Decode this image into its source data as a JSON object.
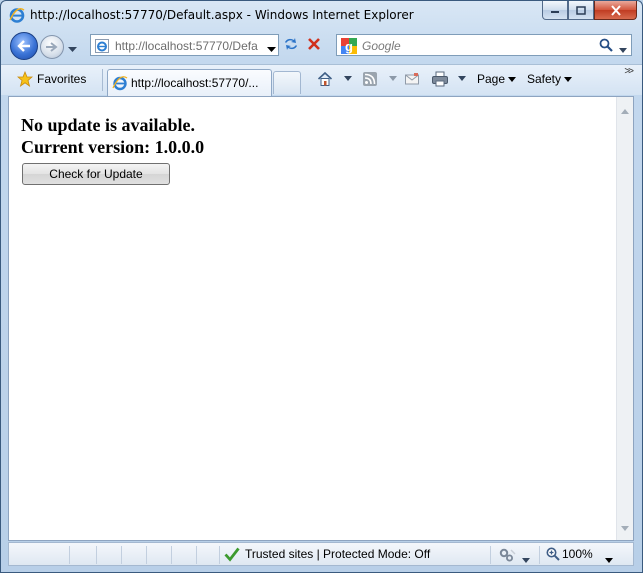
{
  "window": {
    "title": "http://localhost:57770/Default.aspx - Windows Internet Explorer"
  },
  "nav": {
    "address": "http://localhost:57770/Defa",
    "search_placeholder": "Google"
  },
  "command_bar": {
    "favorites_label": "Favorites",
    "tab_label": "http://localhost:57770/...",
    "page_label": "Page",
    "safety_label": "Safety",
    "overflow_label": ">>"
  },
  "page": {
    "status_message": "No update is available.",
    "version_message": "Current version: 1.0.0.0",
    "check_button_label": "Check for Update"
  },
  "status_bar": {
    "zone_text": "Trusted sites | Protected Mode: Off",
    "zoom_text": "100%"
  },
  "colors": {
    "chrome_blue": "#c3d8ee",
    "close_red": "#c03c22",
    "trusted_check_green": "#3c9a2e"
  }
}
